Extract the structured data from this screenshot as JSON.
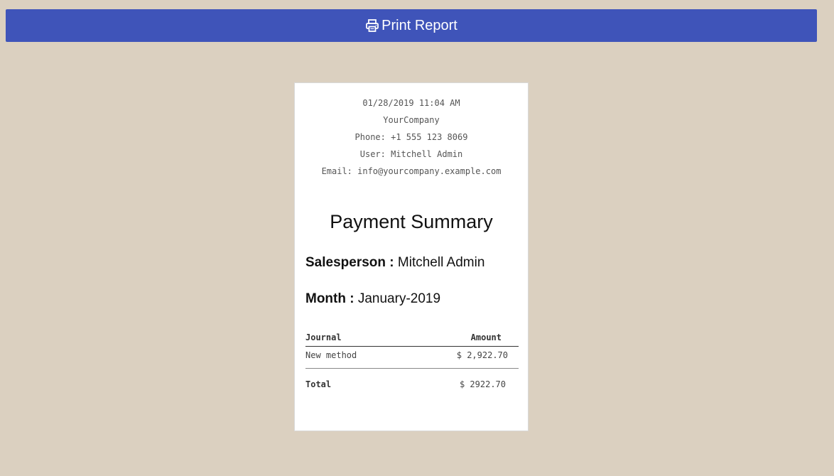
{
  "toolbar": {
    "print_label": "Print Report",
    "print_icon": "printer-icon",
    "accent_color": "#3f54b9"
  },
  "receipt": {
    "datetime": "01/28/2019 11:04 AM",
    "company": "YourCompany",
    "phone": "Phone: +1 555 123 8069",
    "user": "User: Mitchell Admin",
    "email": "Email: info@yourcompany.example.com",
    "title": "Payment Summary",
    "salesperson_label": "Salesperson :",
    "salesperson_value": "Mitchell Admin",
    "month_label": "Month :",
    "month_value": "January-2019",
    "table": {
      "col_journal": "Journal",
      "col_amount": "Amount",
      "rows": [
        {
          "journal": "New method",
          "amount": "$ 2,922.70"
        }
      ],
      "total_label": "Total",
      "total_value": "$ 2922.70"
    }
  }
}
